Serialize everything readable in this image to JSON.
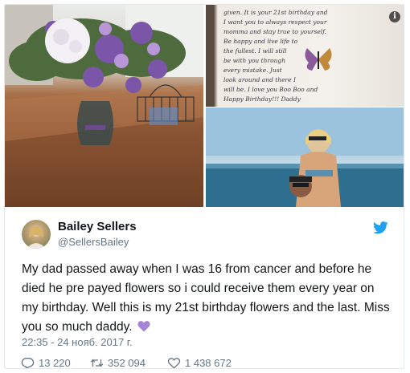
{
  "media": {
    "letter_lines": [
      "given. It is your 21st birthday and",
      "I want you to always respect your",
      "momma and stay true to yourself.",
      "Be happy and live life to",
      "the fullest. I will still",
      "be with you through",
      "every mistake. Just",
      "look around and there I",
      "will be. I love you Boo Boo and",
      "Happy Birthday!!! Daddy"
    ]
  },
  "tweet": {
    "display_name": "Bailey Sellers",
    "handle": "@SellersBailey",
    "text": "My dad passed away when I was 16 from cancer and before he died he pre payed flowers so i could receive them every year on my birthday. Well this is my 21st birthday flowers and the last. Miss you so much daddy.",
    "timestamp": "22:35 - 24 нояб. 2017 г.",
    "replies": "13 220",
    "retweets": "352 094",
    "likes": "1 438 672"
  },
  "colors": {
    "text": "#14171a",
    "secondary": "#657786",
    "twitter_blue": "#1da1f2",
    "heart_purple": "#a785d6"
  },
  "icons": [
    "info-icon",
    "twitter-bird-icon",
    "purple-heart-emoji",
    "reply-icon",
    "retweet-icon",
    "like-icon"
  ]
}
